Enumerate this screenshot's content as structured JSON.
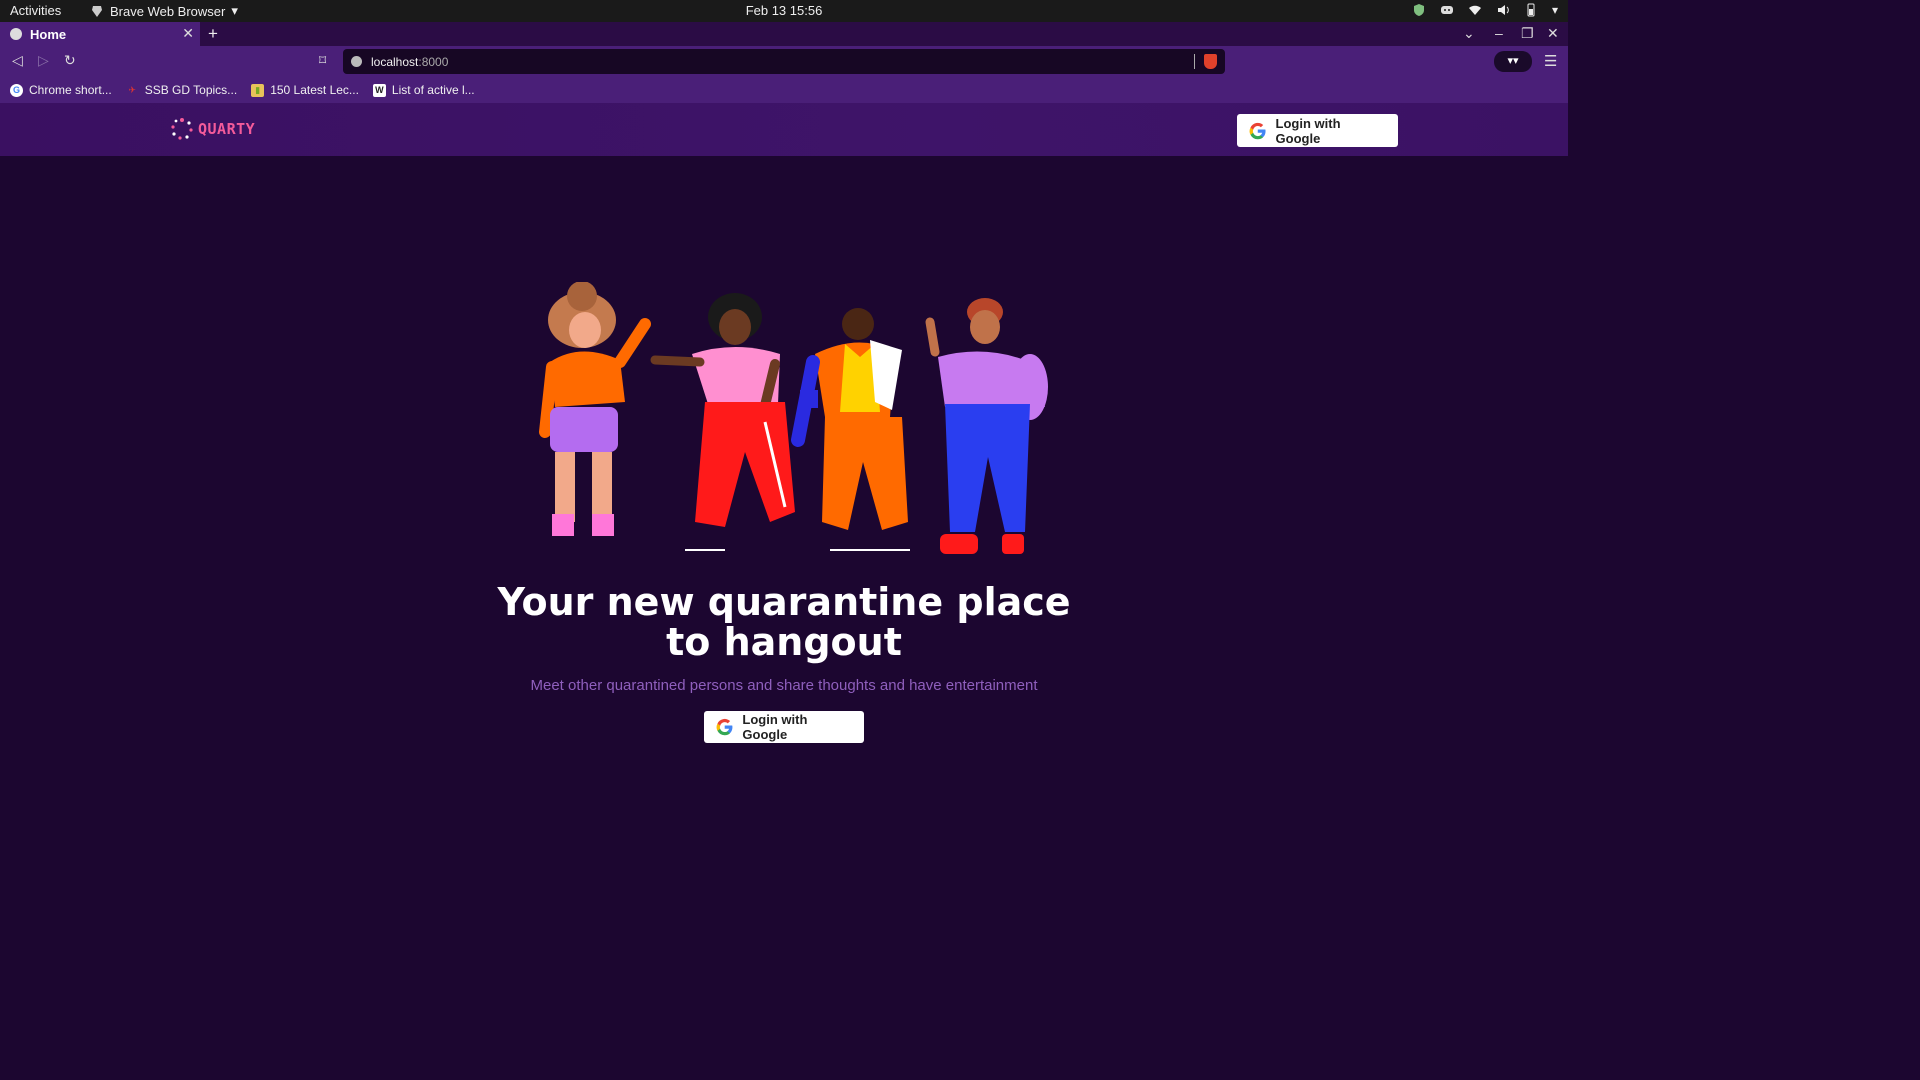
{
  "os": {
    "activities": "Activities",
    "app_name": "Brave Web Browser",
    "clock": "Feb 13  15:56"
  },
  "browser": {
    "tab_title": "Home",
    "url_host": "localhost",
    "url_port": ":8000",
    "bookmarks": [
      {
        "label": "Chrome short...",
        "icon": "google-icon"
      },
      {
        "label": "SSB GD Topics...",
        "icon": "ssb-icon"
      },
      {
        "label": "150 Latest Lec...",
        "icon": "lecture-icon"
      },
      {
        "label": "List of active l...",
        "icon": "wikipedia-icon"
      }
    ]
  },
  "site": {
    "logo_text": "QUARTY",
    "header_login_label": "Login with Google",
    "hero": {
      "title_line1": "Your new quarantine place",
      "title_line2": "to hangout",
      "subtitle": "Meet other quarantined persons and share thoughts and have entertainment",
      "login_label": "Login with Google"
    }
  },
  "colors": {
    "page_bg": "#1c0630",
    "header_bg": "#3a1061",
    "accent_pink": "#f45b9a",
    "subtitle": "#8f5fbd"
  }
}
